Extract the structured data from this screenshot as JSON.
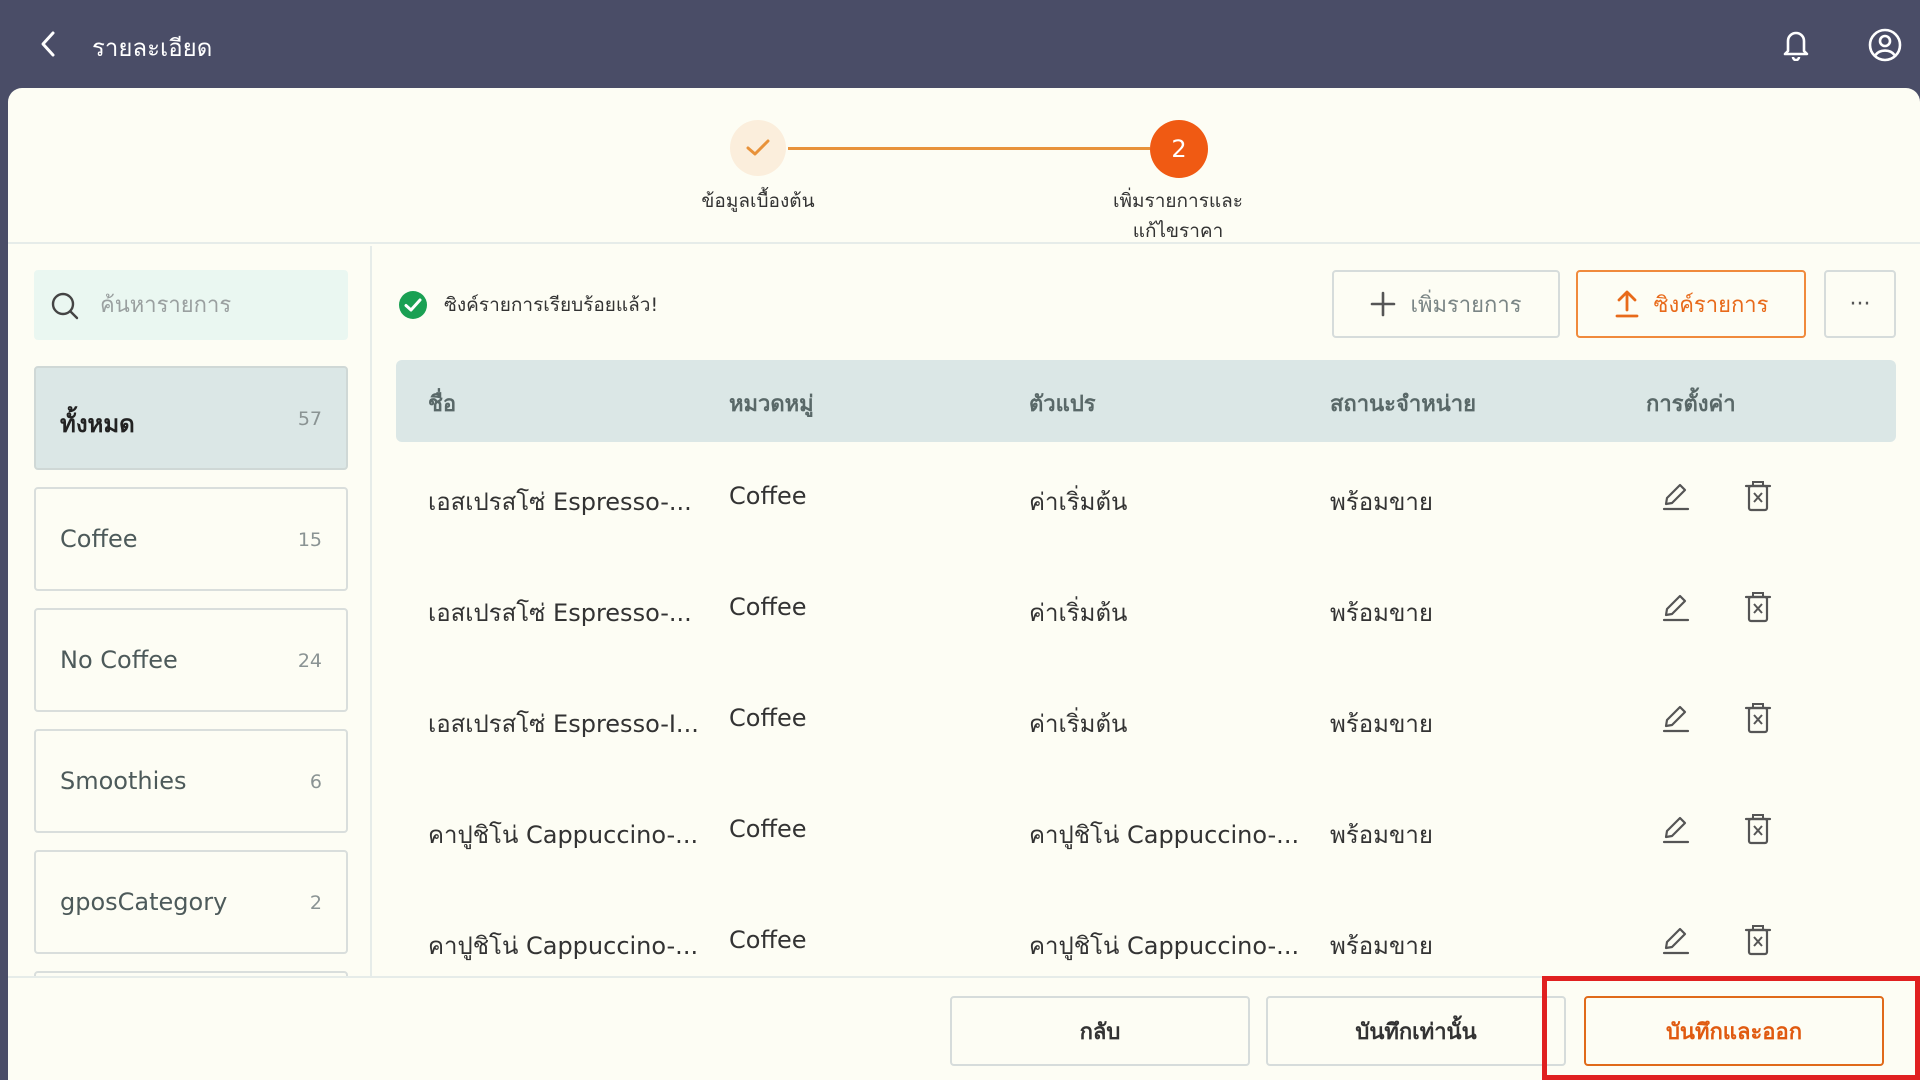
{
  "header": {
    "title": "รายละเอียด",
    "back_icon": "chevron-left-icon",
    "bell_icon": "bell-icon",
    "user_icon": "user-circle-icon"
  },
  "stepper": {
    "step1": {
      "label": "ข้อมูลเบื้องต้น",
      "status": "completed"
    },
    "step2": {
      "number": "2",
      "label_line1": "เพิ่มรายการและ",
      "label_line2": "แก้ไขราคา",
      "status": "active"
    }
  },
  "search": {
    "placeholder": "ค้นหารายการ"
  },
  "categories": [
    {
      "label": "ทั้งหมด",
      "count": "57",
      "active": true
    },
    {
      "label": "Coffee",
      "count": "15",
      "active": false
    },
    {
      "label": "No Coffee",
      "count": "24",
      "active": false
    },
    {
      "label": "Smoothies",
      "count": "6",
      "active": false
    },
    {
      "label": "gposCategory",
      "count": "2",
      "active": false
    }
  ],
  "sync_message": "ซิงค์รายการเรียบร้อยแล้ว!",
  "toolbar": {
    "add_label": "เพิ่มรายการ",
    "sync_label": "ซิงค์รายการ",
    "more_label": "···"
  },
  "table": {
    "headers": {
      "name": "ชื่อ",
      "category": "หมวดหมู่",
      "variant": "ตัวแปร",
      "status": "สถานะจำหน่าย",
      "settings": "การตั้งค่า"
    },
    "rows": [
      {
        "name": "เอสเปรสโซ่ Espresso-...",
        "category": "Coffee",
        "variant": "ค่าเริ่มต้น",
        "status": "พร้อมขาย"
      },
      {
        "name": "เอสเปรสโซ่ Espresso-...",
        "category": "Coffee",
        "variant": "ค่าเริ่มต้น",
        "status": "พร้อมขาย"
      },
      {
        "name": "เอสเปรสโซ่ Espresso-I...",
        "category": "Coffee",
        "variant": "ค่าเริ่มต้น",
        "status": "พร้อมขาย"
      },
      {
        "name": "คาปูชิโน่ Cappuccino-...",
        "category": "Coffee",
        "variant": "คาปูชิโน่ Cappuccino-...",
        "status": "พร้อมขาย"
      },
      {
        "name": "คาปูชิโน่ Cappuccino-...",
        "category": "Coffee",
        "variant": "คาปูชิโน่ Cappuccino-...",
        "status": "พร้อมขาย"
      }
    ]
  },
  "footer": {
    "back_label": "กลับ",
    "save_label": "บันทึกเท่านั้น",
    "save_exit_label": "บันทึกและออก"
  },
  "colors": {
    "topbar": "#4a4d67",
    "accent": "#f05a13",
    "success": "#1aa053",
    "highlight": "#e02020"
  }
}
